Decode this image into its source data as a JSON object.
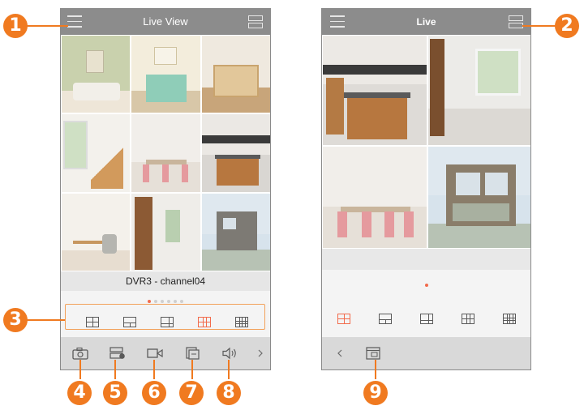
{
  "left_screen": {
    "title": "Live View",
    "channel_label": "DVR3 - channel04",
    "page_dots": 6,
    "active_page": 0,
    "layouts": [
      "layout-1x1",
      "layout-1plus3",
      "layout-1plus5",
      "layout-2x2",
      "layout-3x3"
    ],
    "active_layout": 3
  },
  "right_screen": {
    "title": "Live",
    "page_dots": 1,
    "active_page": 0,
    "layouts": [
      "layout-1x1",
      "layout-1plus3",
      "layout-1plus5",
      "layout-2x2",
      "layout-3x3"
    ],
    "active_layout": 0
  },
  "toolbar_left": [
    "snapshot-icon",
    "record-icon",
    "video-icon",
    "pages-icon",
    "volume-icon",
    "chevron-right-icon"
  ],
  "toolbar_right": [
    "chevron-left-icon",
    "layout-window-icon"
  ],
  "callouts": [
    "1",
    "2",
    "3",
    "4",
    "5",
    "6",
    "7",
    "8",
    "9"
  ],
  "colors": {
    "accent": "#f26b4c",
    "callout": "#f07a20",
    "header": "#8c8c8c",
    "toolbar": "#d9d9d9"
  }
}
